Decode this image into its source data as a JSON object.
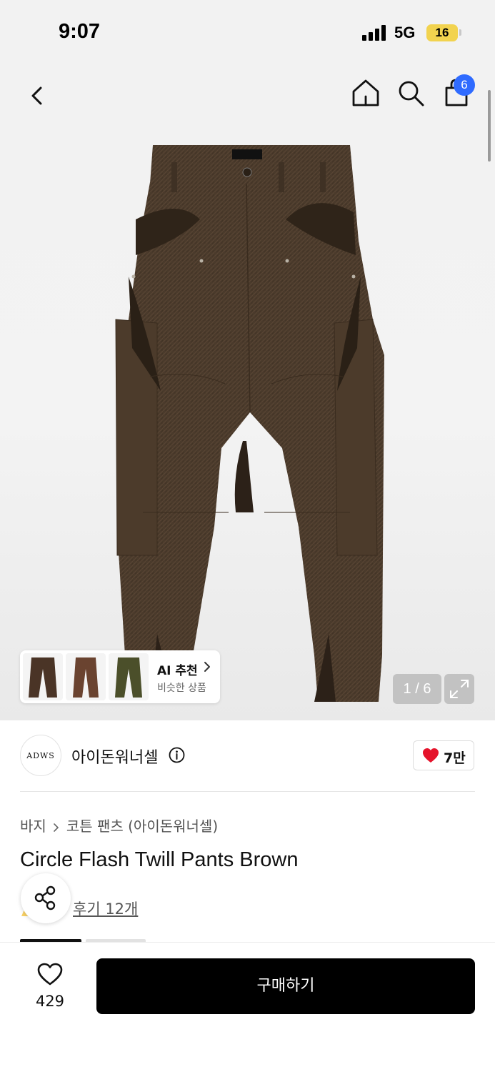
{
  "status_bar": {
    "time": "9:07",
    "network": "5G",
    "battery": "16"
  },
  "header": {
    "cart_count": "6",
    "icons": [
      "chevron-left-icon",
      "home-icon",
      "search-icon",
      "shopping-bag-icon"
    ]
  },
  "gallery": {
    "page_indicator": "1 / 6",
    "current_page": 1,
    "total_pages": 6,
    "ai_recommend": {
      "title": "AI 추천",
      "subtitle": "비슷한 상품"
    }
  },
  "brand": {
    "logo_text": "ADWS",
    "name": "아이돈워너셀",
    "likes": "7만"
  },
  "breadcrumb": {
    "category": "바지",
    "subcategory": "코튼 팬츠 (아이돈워너셀)"
  },
  "product": {
    "title": "Circle Flash Twill Pants Brown",
    "review_link": "후기 12개"
  },
  "bottom_bar": {
    "wish_count": "429",
    "buy_label": "구매하기"
  },
  "colors": {
    "accent_badge": "#2f6bff",
    "heart": "#e5132b",
    "buy_button": "#000000",
    "pants_brown": "#4a3a2b"
  }
}
